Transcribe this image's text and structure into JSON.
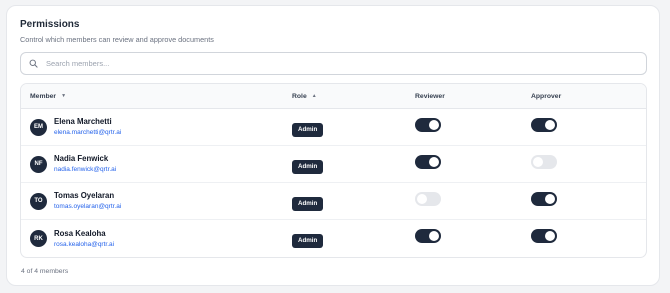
{
  "header": {
    "title": "Permissions",
    "subtitle": "Control which members can review and approve documents"
  },
  "search": {
    "placeholder": "Search members...",
    "value": ""
  },
  "table": {
    "columns": {
      "member": "Member",
      "role": "Role",
      "reviewer": "Reviewer",
      "approver": "Approver"
    },
    "rows": [
      {
        "initials": "EM",
        "name": "Elena Marchetti",
        "email": "elena.marchetti@qrtr.ai",
        "role": "Admin",
        "reviewer": true,
        "approver": true
      },
      {
        "initials": "NF",
        "name": "Nadia Fenwick",
        "email": "nadia.fenwick@qrtr.ai",
        "role": "Admin",
        "reviewer": true,
        "approver": false
      },
      {
        "initials": "TO",
        "name": "Tomas Oyelaran",
        "email": "tomas.oyelaran@qrtr.ai",
        "role": "Admin",
        "reviewer": false,
        "approver": true
      },
      {
        "initials": "RK",
        "name": "Rosa Kealoha",
        "email": "rosa.kealoha@qrtr.ai",
        "role": "Admin",
        "reviewer": true,
        "approver": true
      }
    ]
  },
  "footer": {
    "count_text": "4 of 4 members"
  },
  "icons": {
    "search": "search-icon",
    "sort": "sort-caret-icon"
  },
  "colors": {
    "accent": "#1f2a3d",
    "link": "#2563eb",
    "toggle_off": "#e5e7eb"
  }
}
